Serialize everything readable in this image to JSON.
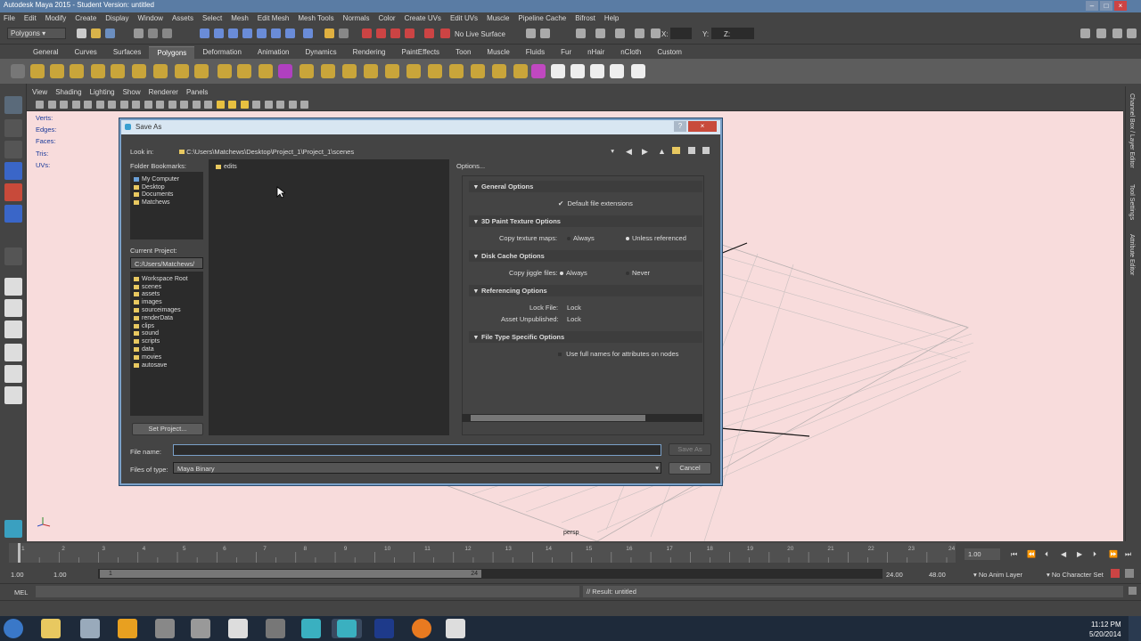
{
  "window": {
    "title": "Autodesk Maya 2015 - Student Version: untitled"
  },
  "menus": [
    "File",
    "Edit",
    "Modify",
    "Create",
    "Display",
    "Window",
    "Assets",
    "Select",
    "Mesh",
    "Edit Mesh",
    "Mesh Tools",
    "Normals",
    "Color",
    "Create UVs",
    "Edit UVs",
    "Muscle",
    "Pipeline Cache",
    "Bifrost",
    "Help"
  ],
  "status": {
    "mode": "Polygons",
    "live_surface": "No Live Surface",
    "x_label": "X:",
    "y_label": "Y:",
    "z_label": "Z:"
  },
  "shelf_tabs": [
    "General",
    "Curves",
    "Surfaces",
    "Polygons",
    "Deformation",
    "Animation",
    "Dynamics",
    "Rendering",
    "PaintEffects",
    "Toon",
    "Muscle",
    "Fluids",
    "Fur",
    "nHair",
    "nCloth",
    "Custom"
  ],
  "shelf_active": "Polygons",
  "panel_menus": [
    "View",
    "Shading",
    "Lighting",
    "Show",
    "Renderer",
    "Panels"
  ],
  "hud": {
    "labels": [
      "Verts:",
      "Edges:",
      "Faces:",
      "Tris:",
      "UVs:"
    ]
  },
  "viewport": {
    "camera": "persp"
  },
  "right_strip": {
    "tabs": [
      "Channel Box / Layer Editor",
      "Tool Settings",
      "Attribute Editor"
    ]
  },
  "dialog": {
    "title": "Save As",
    "look_in_label": "Look in:",
    "look_in_path": "C:\\Users\\Matchews\\Desktop\\Project_1\\Project_1\\scenes",
    "bookmarks_label": "Folder Bookmarks:",
    "bookmarks": [
      "My Computer",
      "Desktop",
      "Documents",
      "Matchews"
    ],
    "current_project_label": "Current Project:",
    "current_project": "C:/Users/Matchews/",
    "project_tree": [
      "Workspace Root",
      "scenes",
      "assets",
      "images",
      "sourceimages",
      "renderData",
      "clips",
      "sound",
      "scripts",
      "data",
      "movies",
      "autosave"
    ],
    "set_project": "Set Project...",
    "files": [
      "edits"
    ],
    "options_label": "Options...",
    "sections": [
      {
        "title": "General Options"
      },
      {
        "title": "3D Paint Texture Options"
      },
      {
        "title": "Disk Cache Options"
      },
      {
        "title": "Referencing Options"
      },
      {
        "title": "File Type Specific Options"
      }
    ],
    "default_ext": "Default file extensions",
    "copy_tex_label": "Copy texture maps:",
    "always": "Always",
    "unless": "Unless referenced",
    "copy_jiggle_label": "Copy jiggle files:",
    "never": "Never",
    "lock_file_label": "Lock File:",
    "lock": "Lock",
    "asset_unpub_label": "Asset Unpublished:",
    "full_names": "Use full names for attributes on nodes",
    "file_name_label": "File name:",
    "file_name": "",
    "files_of_type_label": "Files of type:",
    "file_type": "Maya Binary",
    "save_as": "Save As",
    "cancel": "Cancel"
  },
  "timeline": {
    "ticks": [
      "1",
      "2",
      "3",
      "4",
      "5",
      "6",
      "7",
      "8",
      "9",
      "10",
      "11",
      "12",
      "13",
      "14",
      "15",
      "16",
      "17",
      "18",
      "19",
      "20",
      "21",
      "22",
      "23",
      "24"
    ],
    "current": "1.00"
  },
  "range": {
    "start": "1.00",
    "start_inner": "1.00",
    "slider_start": "1",
    "slider_end": "24",
    "end_inner": "24.00",
    "end": "48.00",
    "anim_layer": "No Anim Layer",
    "char_set": "No Character Set"
  },
  "cmd": {
    "lang": "MEL",
    "result": "// Result: untitled"
  },
  "taskbar": {
    "time": "11:12 PM",
    "date": "5/20/2014"
  }
}
